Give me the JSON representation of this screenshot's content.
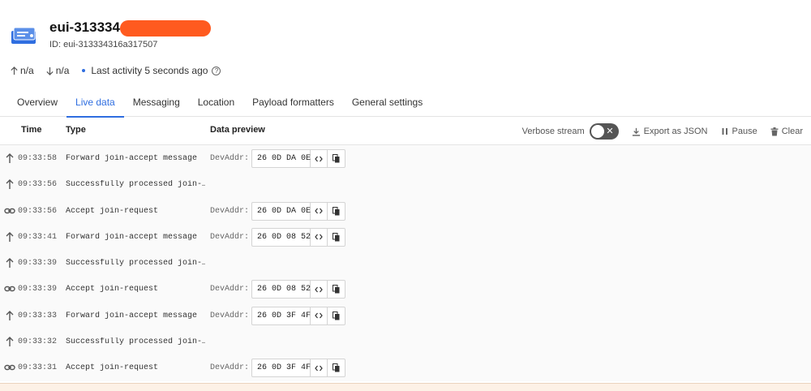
{
  "device": {
    "title": "eui-313334",
    "id_text": "ID: eui-313334316a317507"
  },
  "stats": {
    "uplink": "n/a",
    "downlink": "n/a",
    "last_activity": "Last activity 5 seconds ago"
  },
  "tabs": [
    {
      "label": "Overview"
    },
    {
      "label": "Live data"
    },
    {
      "label": "Messaging"
    },
    {
      "label": "Location"
    },
    {
      "label": "Payload formatters"
    },
    {
      "label": "General settings"
    }
  ],
  "table": {
    "col_time": "Time",
    "col_type": "Type",
    "col_preview": "Data preview",
    "verbose_label": "Verbose stream",
    "export_label": "Export as JSON",
    "pause_label": "Pause",
    "clear_label": "Clear",
    "devaddr_label": "DevAddr:",
    "rows": [
      {
        "icon": "arrow-up-icon",
        "time": "09:33:58",
        "type": "Forward join-accept message",
        "devaddr": "26 0D DA 0E"
      },
      {
        "icon": "arrow-up-icon",
        "time": "09:33:56",
        "type": "Successfully processed join-…",
        "devaddr": ""
      },
      {
        "icon": "link-icon",
        "time": "09:33:56",
        "type": "Accept join-request",
        "devaddr": "26 0D DA 0E"
      },
      {
        "icon": "arrow-up-icon",
        "time": "09:33:41",
        "type": "Forward join-accept message",
        "devaddr": "26 0D 08 52"
      },
      {
        "icon": "arrow-up-icon",
        "time": "09:33:39",
        "type": "Successfully processed join-…",
        "devaddr": ""
      },
      {
        "icon": "link-icon",
        "time": "09:33:39",
        "type": "Accept join-request",
        "devaddr": "26 0D 08 52"
      },
      {
        "icon": "arrow-up-icon",
        "time": "09:33:33",
        "type": "Forward join-accept message",
        "devaddr": "26 0D 3F 4F"
      },
      {
        "icon": "arrow-up-icon",
        "time": "09:33:32",
        "type": "Successfully processed join-…",
        "devaddr": ""
      },
      {
        "icon": "link-icon",
        "time": "09:33:31",
        "type": "Accept join-request",
        "devaddr": "26 0D 3F 4F"
      }
    ]
  },
  "colors": {
    "accent": "#2f6ee0",
    "redaction": "#ff5a1f"
  }
}
